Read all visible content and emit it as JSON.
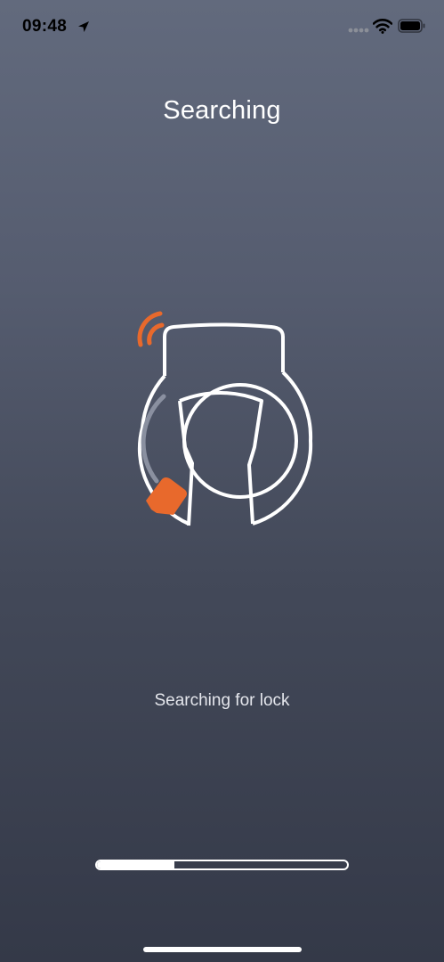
{
  "status_bar": {
    "time": "09:48",
    "icons": [
      "location-arrow-icon",
      "signal-dots-icon",
      "wifi-icon",
      "battery-icon"
    ]
  },
  "header": {
    "title": "Searching"
  },
  "illustration": {
    "icon": "bike-lock-icon",
    "signal_icon": "bluetooth-signal-icon",
    "accent_color": "#e8692c",
    "line_color": "#ffffff",
    "muted_line_color": "#8a90a0"
  },
  "status": {
    "message": "Searching for lock"
  },
  "progress": {
    "fraction": 0.31
  },
  "colors": {
    "background_top": "#626a7d",
    "background_bottom": "#343948",
    "accent": "#e8692c"
  }
}
